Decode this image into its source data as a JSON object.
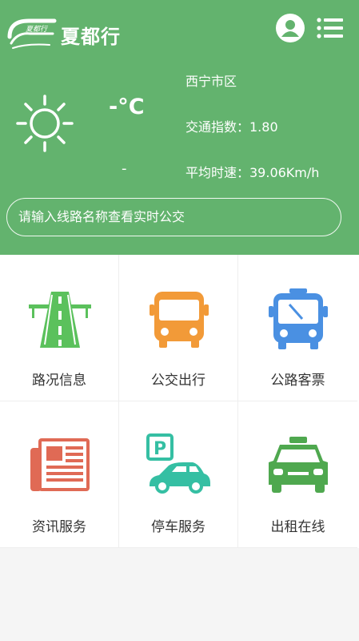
{
  "app": {
    "title": "夏都行"
  },
  "header": {
    "user_icon": "user-avatar-icon",
    "menu_icon": "list-menu-icon",
    "weather_icon": "sun-icon"
  },
  "weather": {
    "temperature": "-°C",
    "sub": "-"
  },
  "traffic": {
    "city": "西宁市区",
    "index_text": "交通指数：1.80",
    "speed_text": "平均时速：39.06Km/h"
  },
  "search": {
    "placeholder": "请输入线路名称查看实时公交"
  },
  "tiles": [
    {
      "label": "路况信息",
      "icon": "road-icon"
    },
    {
      "label": "公交出行",
      "icon": "bus-icon"
    },
    {
      "label": "公路客票",
      "icon": "coach-icon"
    },
    {
      "label": "资讯服务",
      "icon": "newspaper-icon"
    },
    {
      "label": "停车服务",
      "icon": "parking-car-icon"
    },
    {
      "label": "出租在线",
      "icon": "taxi-icon"
    }
  ],
  "colors": {
    "header_green": "#63b36e",
    "road_green": "#5bc15c",
    "bus_orange": "#f29a38",
    "coach_blue": "#4a90e2",
    "news_red": "#e06a55",
    "parking_teal": "#35bfa3",
    "taxi_green": "#4fa84f"
  }
}
